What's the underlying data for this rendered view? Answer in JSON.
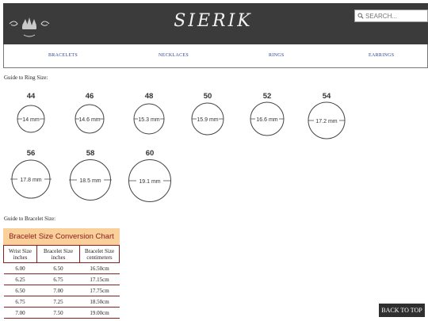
{
  "header": {
    "brand": "SIERIK",
    "search_placeholder": "SEARCH...",
    "search_icon": "search-icon",
    "logo_icon": "ornament-logo-icon"
  },
  "nav": [
    "BRACELETS",
    "NECKLACES",
    "RINGS",
    "EARRINGS"
  ],
  "ring_guide": {
    "heading": "Guide to Ring Size:",
    "rings": [
      {
        "size": "44",
        "diameter": "14 mm"
      },
      {
        "size": "46",
        "diameter": "14.6 mm"
      },
      {
        "size": "48",
        "diameter": "15.3 mm"
      },
      {
        "size": "50",
        "diameter": "15.9 mm"
      },
      {
        "size": "52",
        "diameter": "16.6 mm"
      },
      {
        "size": "54",
        "diameter": "17.2 mm"
      },
      {
        "size": "56",
        "diameter": "17.8 mm"
      },
      {
        "size": "58",
        "diameter": "18.5 mm"
      },
      {
        "size": "60",
        "diameter": "19.1 mm"
      }
    ]
  },
  "bracelet_guide": {
    "heading": "Guide to Bracelet Size:",
    "chart_title": "Bracelet Size Conversion Chart",
    "columns": [
      "Wrist Size inches",
      "Bracelet Size inches",
      "Bracelet Size centimeters"
    ],
    "rows": [
      [
        "6.00",
        "6.50",
        "16.50cm"
      ],
      [
        "6.25",
        "6.75",
        "17.15cm"
      ],
      [
        "6.50",
        "7.00",
        "17.75cm"
      ],
      [
        "6.75",
        "7.25",
        "18.50cm"
      ],
      [
        "7.00",
        "7.50",
        "19.00cm"
      ]
    ]
  },
  "back_to_top": "BACK TO TOP",
  "colors": {
    "header_bg": "#3b3b3b",
    "nav_link": "#2a3f9c",
    "chart_title_bg": "#f9cf9a",
    "chart_title_text": "#8b1a1a",
    "table_border": "#8a1f1f"
  }
}
